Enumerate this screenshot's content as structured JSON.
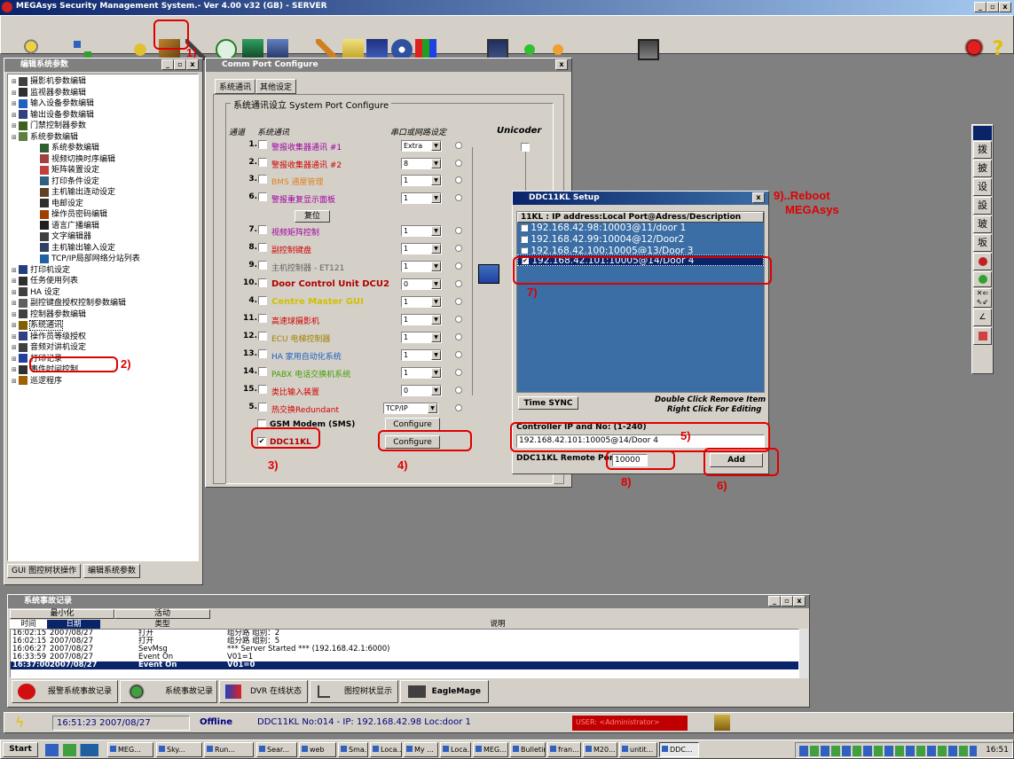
{
  "app_title": "MEGAsys Security Management System.- Ver 4.00 v32 (GB) - SERVER",
  "annotations": {
    "a1": "1)",
    "a2": "2)",
    "a3": "3)",
    "a4": "4)",
    "a5": "5)",
    "a6": "6)",
    "a7": "7)",
    "a8": "8)",
    "a9a": "9)..Reboot",
    "a9b": "MEGAsys"
  },
  "tree_window": {
    "title": "编辑系统参数",
    "items": [
      "摄影机参数编辑",
      "监视器参数编辑",
      "输入设备参数编辑",
      "输出设备参数编辑",
      "门禁控制器参数",
      "系统参数编辑",
      "系统参数编辑",
      "视频切换时序编辑",
      "矩阵装置设定",
      "打印条件设定",
      "主机输出连动设定",
      "电邮设定",
      "操作员密码编辑",
      "语言广播编辑",
      "文字编辑器",
      "主机输出输入设定",
      "TCP/IP局部网络分站列表",
      "打印机设定",
      "任务使用列表",
      "HA 设定",
      "副控键盘授权控制参数编辑",
      "控制器参数编辑",
      "系统通讯",
      "操作员等级授权",
      "音频对讲机设定",
      "打印记录",
      "事件时间控制",
      "巡逻程序"
    ],
    "bottom_tabs": [
      "GUI 图控树状操作",
      "编辑系统参数"
    ]
  },
  "comm_window": {
    "title": "Comm Port Configure",
    "tabs": [
      "系统通讯",
      "其他设定"
    ],
    "group_title": "系统通讯设立 System Port Configure",
    "col_headers": [
      "通道",
      "系统通讯",
      "串口或网路设定",
      "Unicoder"
    ],
    "rows": [
      {
        "num": "1.",
        "label": "警报收集器通讯 #1",
        "color": "#a000a0",
        "val": "Extra"
      },
      {
        "num": "2.",
        "label": "警报收集器通讯 #2",
        "color": "#d00000",
        "val": "8"
      },
      {
        "num": "3.",
        "label": "BMS 通屋管理",
        "color": "#e08020",
        "val": "1"
      },
      {
        "num": "6.",
        "label": "警报重复显示面板",
        "color": "#a000a0",
        "val": "1"
      },
      {
        "num": "7.",
        "label": "视频矩阵控制",
        "color": "#a000a0",
        "val": "1"
      },
      {
        "num": "8.",
        "label": "副控制键盘",
        "color": "#d00000",
        "val": "1"
      },
      {
        "num": "9.",
        "label": "主机控制器 - ET121",
        "color": "#606060",
        "val": "1"
      },
      {
        "num": "10.",
        "label": "Door Control Unit DCU2",
        "color": "#b00000",
        "val": "0"
      },
      {
        "num": "4.",
        "label": "Centre Master GUI",
        "color": "#d0c000",
        "val": "1"
      },
      {
        "num": "11.",
        "label": "高速球摄影机",
        "color": "#d00000",
        "val": "1"
      },
      {
        "num": "12.",
        "label": "ECU 电梯控制器",
        "color": "#a08000",
        "val": "1"
      },
      {
        "num": "13.",
        "label": "HA 家用自动化系统",
        "color": "#2060c0",
        "val": "1"
      },
      {
        "num": "14.",
        "label": "PABX 电话交换机系统",
        "color": "#40a000",
        "val": "1"
      },
      {
        "num": "15.",
        "label": "类比输入装置",
        "color": "#d00000",
        "val": "0"
      },
      {
        "num": "5.",
        "label": "热交换Redundant",
        "color": "#d00000",
        "val": "TCP/IP"
      }
    ],
    "reset_btn": "复位",
    "gsm_label": "GSM Modem (SMS)",
    "ddc_label": "DDC11KL",
    "configure": "Configure"
  },
  "ddc_window": {
    "title": "DDC11KL Setup",
    "header": "11KL : IP address:Local Port@Adress/Description",
    "items": [
      "192.168.42.98:10003@11/door 1",
      "192.168.42.99:10004@12/Door2",
      "192.168.42.100:10005@13/Door 3",
      "192.168.42.101:10005@14/Door 4"
    ],
    "time_sync": "Time SYNC",
    "hint1": "Double Click Remove Item",
    "hint2": "Right Click For Editing",
    "ctrl_label": "Controller IP  and No: (1-240)",
    "ctrl_value": "192.168.42.101:10005@14/Door 4",
    "port_label": "DDC11KL Remote Port:",
    "port_value": "10000",
    "add": "Add"
  },
  "side_toolbar": [
    "拨",
    "披",
    "设",
    "設",
    "玻",
    "坂"
  ],
  "event_window": {
    "title": "系统事故记录",
    "tabs": [
      "最小化",
      "活动"
    ],
    "headers": [
      "时间",
      "日期",
      "类型",
      "",
      "说明"
    ],
    "rows": [
      [
        "16:02:15",
        "2007/08/27",
        "打开",
        "组分路  组别：2"
      ],
      [
        "16:02:15",
        "2007/08/27",
        "打开",
        "组分路  组别：5"
      ],
      [
        "16:06:27",
        "2007/08/27",
        "SevMsg",
        "*** Server Started *** (192.168.42.1:6000)"
      ],
      [
        "16:33:59",
        "2007/08/27",
        "Event On",
        "V01=1"
      ],
      [
        "16:37:00",
        "2007/08/27",
        "Event On",
        "V01=0"
      ]
    ]
  },
  "bottom_buttons": [
    "报警系统事故记录",
    "系统事故记录",
    "DVR 在线状态",
    "图控树状显示",
    "EagleMage"
  ],
  "status": {
    "time": "16:51:23  2007/08/27",
    "state": "Offline",
    "info": "DDC11KL No:014 - IP: 192.168.42.98 Loc:door 1",
    "user": "USER: <Administrator>"
  },
  "taskbar": {
    "start": "Start",
    "items": [
      "MEG...",
      "Sky...",
      "Run...",
      "Sear...",
      "web",
      "Sma...",
      "Loca...",
      "My ...",
      "Loca...",
      "MEG...",
      "Bulletin",
      "fran...",
      "M20...",
      "untit...",
      "DDC..."
    ],
    "clock": "16:51"
  },
  "colors": {
    "title_blue": "#0a246a",
    "list_blue": "#3a6ea5",
    "annot_red": "#e00000"
  }
}
